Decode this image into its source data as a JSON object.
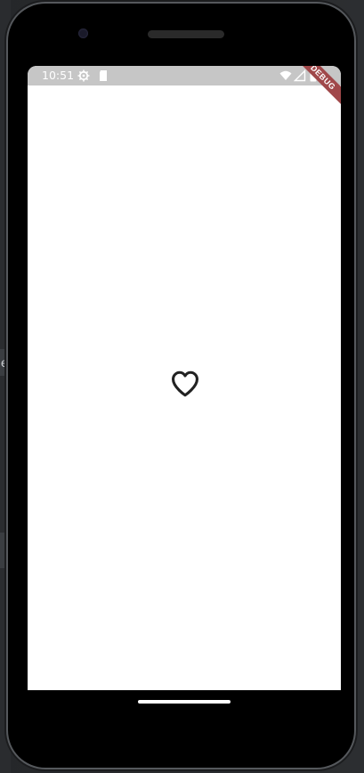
{
  "status_bar": {
    "time": "10:51",
    "icons": [
      "settings-gear-icon",
      "sd-card-icon",
      "wifi-icon",
      "cell-signal-icon",
      "battery-icon"
    ]
  },
  "debug_banner": {
    "label": "DEBUG"
  },
  "content": {
    "icon": "heart-outline-icon"
  },
  "colors": {
    "status_bar_bg": "#c6c6c6",
    "screen_bg": "#ffffff",
    "banner_bg": "#a0484a",
    "heart_stroke": "#222222"
  },
  "background": {
    "left_tab_text": "e"
  }
}
